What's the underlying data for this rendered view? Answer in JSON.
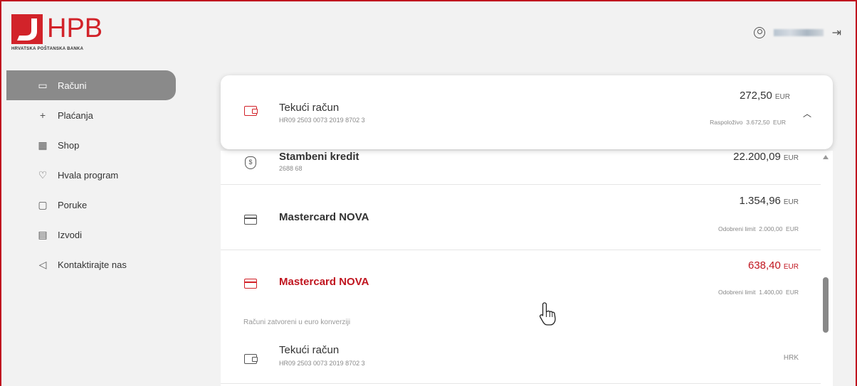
{
  "brand": {
    "name": "HPB",
    "subtitle": "HRVATSKA POŠTANSKA BANKA",
    "color": "#d2232a"
  },
  "header": {
    "user_icon": "user-circle-icon",
    "logout_icon": "logout-icon"
  },
  "sidebar": {
    "items": [
      {
        "label": "Računi",
        "icon": "wallet-icon",
        "active": true
      },
      {
        "label": "Plaćanja",
        "icon": "plus-icon",
        "active": false
      },
      {
        "label": "Shop",
        "icon": "grid-plus-icon",
        "active": false
      },
      {
        "label": "Hvala program",
        "icon": "gift-hand-icon",
        "active": false
      },
      {
        "label": "Poruke",
        "icon": "message-icon",
        "active": false
      },
      {
        "label": "Izvodi",
        "icon": "statement-icon",
        "active": false
      },
      {
        "label": "Kontaktirajte nas",
        "icon": "megaphone-icon",
        "active": false
      }
    ]
  },
  "top_account": {
    "name": "Tekući račun",
    "iban": "HR09 2503 0073 2019 8702 3",
    "amount": "272,50",
    "currency": "EUR",
    "available_label": "Raspoloživo",
    "available_value": "3.672,50",
    "available_currency": "EUR"
  },
  "accounts": [
    {
      "name": "Stambeni kredit",
      "sub": "2688 68",
      "amount": "22.200,09",
      "currency": "EUR"
    },
    {
      "name": "Mastercard NOVA",
      "amount": "1.354,96",
      "currency": "EUR",
      "limit_label": "Odobreni limit",
      "limit_value": "2.000,00",
      "limit_currency": "EUR"
    },
    {
      "name": "Mastercard NOVA",
      "amount": "638,40",
      "currency": "EUR",
      "limit_label": "Odobreni limit",
      "limit_value": "1.400,00",
      "limit_currency": "EUR"
    }
  ],
  "closed_section": {
    "label": "Računi zatvoreni u euro konverziji",
    "account": {
      "name": "Tekući račun",
      "iban": "HR09 2503 0073 2019 8702 3",
      "currency": "HRK"
    }
  },
  "colors": {
    "accent": "#c0151f",
    "active_nav": "#8a8a8a"
  }
}
